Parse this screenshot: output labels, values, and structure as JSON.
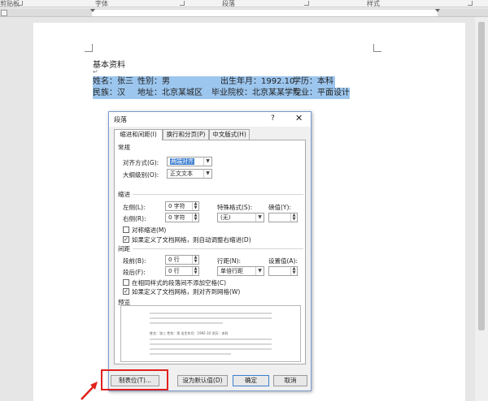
{
  "ribbon": {
    "groups": [
      "剪贴板",
      "字体",
      "段落",
      "样式"
    ]
  },
  "document": {
    "title": "基本资料",
    "row1": [
      "姓名：张三",
      "性别：男",
      "出生年月：1992.10",
      "学历：本科"
    ],
    "row2": [
      "民族：汉",
      "地址：北京某城区",
      "毕业院校：北京某某学院",
      "专业：平面设计"
    ]
  },
  "dialog": {
    "title": "段落",
    "help": "?",
    "close": "✕",
    "tabs": [
      "缩进和间距(I)",
      "换行和分页(P)",
      "中文版式(H)"
    ],
    "general": {
      "section": "常规",
      "align_label": "对齐方式(G):",
      "align_value": "两端对齐",
      "outline_label": "大纲级别(O):",
      "outline_value": "正文文本"
    },
    "indent": {
      "section": "缩进",
      "left_label": "左侧(L):",
      "left_value": "0 字符",
      "right_label": "右侧(R):",
      "right_value": "0 字符",
      "special_label": "特殊格式(S):",
      "special_value": "(无)",
      "by_label": "磅值(Y):",
      "by_value": "",
      "mirror_label": "对称缩进(M)",
      "auto_label": "如果定义了文档网格，则自动调整右缩进(D)"
    },
    "spacing": {
      "section": "间距",
      "before_label": "段前(B):",
      "before_value": "0 行",
      "after_label": "段后(F):",
      "after_value": "0 行",
      "line_label": "行距(N):",
      "line_value": "单倍行距",
      "at_label": "设置值(A):",
      "at_value": "",
      "nospace_label": "在相同样式的段落间不添加空格(C)",
      "grid_label": "如果定义了文档网格，则对齐到网格(W)"
    },
    "preview": {
      "section": "预览",
      "sample": "姓名：张三   性别：男   出生年月：1992.10   学历：本科"
    },
    "buttons": {
      "tabs": "制表位(T)...",
      "default": "设为默认值(D)",
      "ok": "确定",
      "cancel": "取消"
    }
  },
  "colors": {
    "selection": "#9cc6ee",
    "highlight": "#e0211c",
    "accent": "#3f7fd0"
  }
}
